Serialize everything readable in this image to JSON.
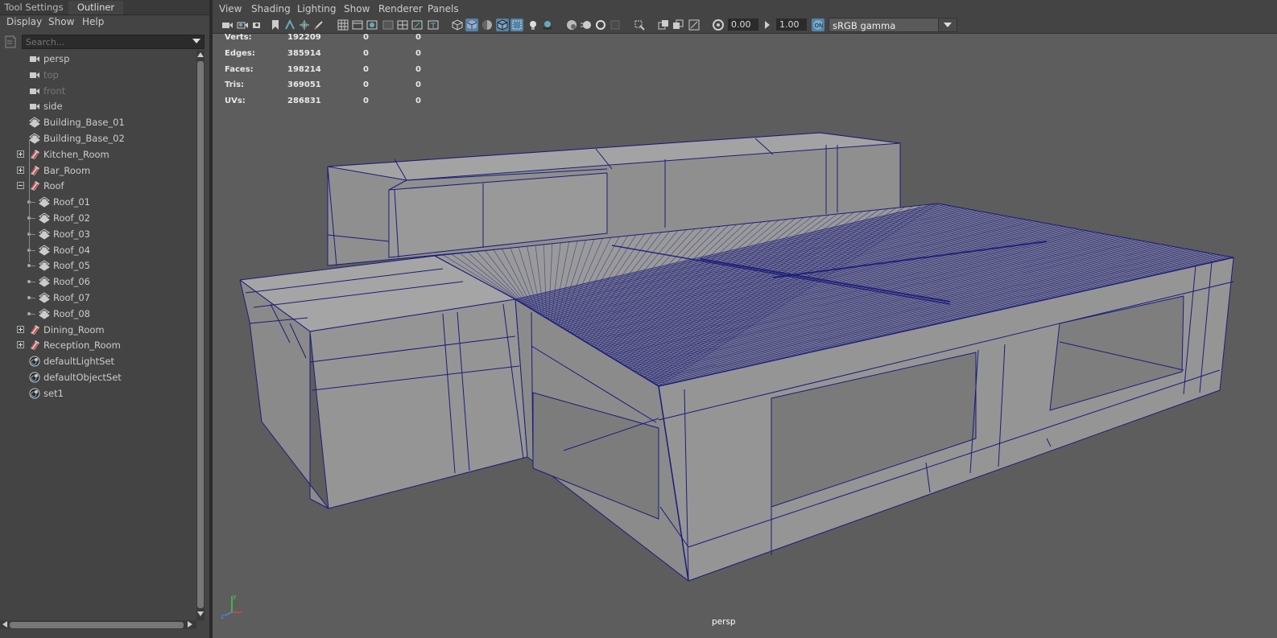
{
  "panel_tabs": [
    {
      "label": "Tool Settings"
    },
    {
      "label": "Outliner"
    }
  ],
  "outliner": {
    "menus": [
      "Display",
      "Show",
      "Help"
    ],
    "search_placeholder": "Search...",
    "items": [
      {
        "label": "persp",
        "icon": "camera-icon"
      },
      {
        "label": "top",
        "icon": "camera-icon",
        "hidden": true
      },
      {
        "label": "front",
        "icon": "camera-icon",
        "hidden": true
      },
      {
        "label": "side",
        "icon": "camera-icon"
      },
      {
        "label": "Building_Base_01",
        "icon": "mesh-icon"
      },
      {
        "label": "Building_Base_02",
        "icon": "mesh-icon"
      },
      {
        "label": "Kitchen_Room",
        "icon": "group-icon",
        "expandable": "collapsed"
      },
      {
        "label": "Bar_Room",
        "icon": "group-icon",
        "expandable": "collapsed"
      },
      {
        "label": "Roof",
        "icon": "group-icon",
        "expandable": "expanded"
      },
      {
        "label": "Roof_01",
        "icon": "mesh-icon",
        "child": true
      },
      {
        "label": "Roof_02",
        "icon": "mesh-icon",
        "child": true
      },
      {
        "label": "Roof_03",
        "icon": "mesh-icon",
        "child": true
      },
      {
        "label": "Roof_04",
        "icon": "mesh-icon",
        "child": true
      },
      {
        "label": "Roof_05",
        "icon": "mesh-icon",
        "child": true
      },
      {
        "label": "Roof_06",
        "icon": "mesh-icon",
        "child": true
      },
      {
        "label": "Roof_07",
        "icon": "mesh-icon",
        "child": true
      },
      {
        "label": "Roof_08",
        "icon": "mesh-icon",
        "child": true
      },
      {
        "label": "Dining_Room",
        "icon": "group-icon",
        "expandable": "collapsed"
      },
      {
        "label": "Reception_Room",
        "icon": "group-icon",
        "expandable": "collapsed"
      },
      {
        "label": "defaultLightSet",
        "icon": "set-icon"
      },
      {
        "label": "defaultObjectSet",
        "icon": "set-icon"
      },
      {
        "label": "set1",
        "icon": "set-icon"
      }
    ]
  },
  "viewport": {
    "menus": [
      "View",
      "Shading",
      "Lighting",
      "Show",
      "Renderer",
      "Panels"
    ],
    "exposure": "0.00",
    "gamma": "1.00",
    "color_space": "sRGB gamma",
    "camera": "persp",
    "hud": [
      {
        "label": "Verts:",
        "values": [
          "192209",
          "0",
          "0"
        ]
      },
      {
        "label": "Edges:",
        "values": [
          "385914",
          "0",
          "0"
        ]
      },
      {
        "label": "Faces:",
        "values": [
          "198214",
          "0",
          "0"
        ]
      },
      {
        "label": "Tris:",
        "values": [
          "369051",
          "0",
          "0"
        ]
      },
      {
        "label": "UVs:",
        "values": [
          "286831",
          "0",
          "0"
        ]
      }
    ]
  },
  "colors": {
    "wire": "#1c1c7a",
    "face": "#9a9a9a",
    "active_tool": "#5285a6",
    "viewport_bg": "#5d5d5d"
  }
}
